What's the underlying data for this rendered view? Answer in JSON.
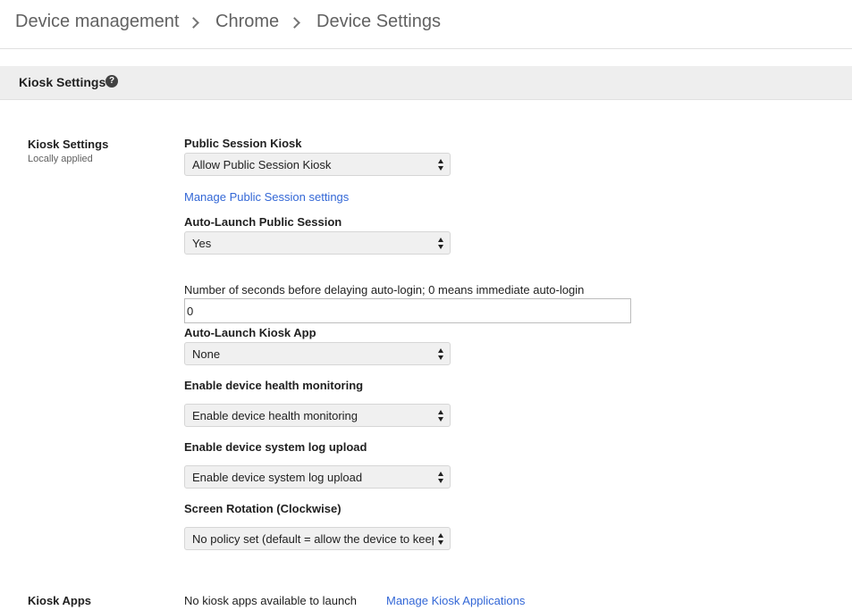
{
  "breadcrumb": {
    "items": [
      "Device management",
      "Chrome",
      "Device Settings"
    ]
  },
  "section": {
    "title": "Kiosk Settings",
    "help_icon": "question-circle-icon"
  },
  "kiosk_settings": {
    "label": "Kiosk Settings",
    "sublabel": "Locally applied",
    "public_session_kiosk": {
      "label": "Public Session Kiosk",
      "value": "Allow Public Session Kiosk"
    },
    "manage_public_session_link": "Manage Public Session settings",
    "auto_launch_public_session": {
      "label": "Auto-Launch Public Session",
      "value": "Yes"
    },
    "auto_login_delay": {
      "label": "Number of seconds before delaying auto-login; 0 means immediate auto-login",
      "value": "0"
    },
    "auto_launch_kiosk_app": {
      "label": "Auto-Launch Kiosk App",
      "value": "None"
    },
    "device_health_monitoring": {
      "label": "Enable device health monitoring",
      "value": "Enable device health monitoring"
    },
    "system_log_upload": {
      "label": "Enable device system log upload",
      "value": "Enable device system log upload"
    },
    "screen_rotation": {
      "label": "Screen Rotation (Clockwise)",
      "value": "No policy set (default = allow the device to keep"
    }
  },
  "kiosk_apps": {
    "label": "Kiosk Apps",
    "status": "No kiosk apps available to launch",
    "manage_link": "Manage Kiosk Applications"
  },
  "colors": {
    "link": "#3367d6",
    "section_bar": "#eeeeee",
    "select_bg": "#f0f0f0"
  }
}
